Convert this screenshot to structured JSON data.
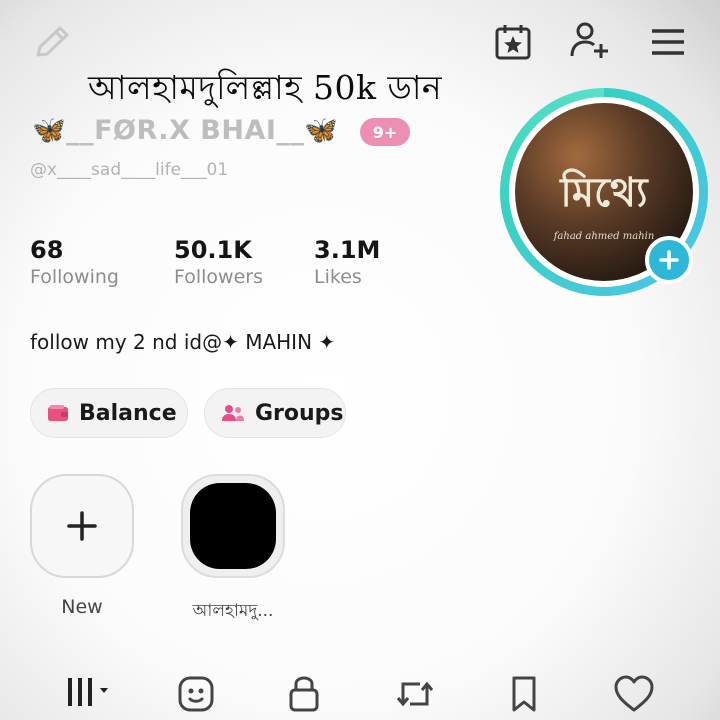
{
  "overlay": {
    "caption": "আলহামদুলিল্লাহ 50k ডান"
  },
  "topbar": {
    "icons": [
      "pencil-icon",
      "calendar-star-icon",
      "add-user-icon",
      "menu-icon"
    ]
  },
  "profile": {
    "display_name": "🦋__FØR.X BHAI__🦋",
    "badge": "9+",
    "username": "@x____sad____life___01",
    "avatar_text": "মিথ্যে",
    "avatar_subtext": "fahad ahmed mahin"
  },
  "stats": [
    {
      "value": "68",
      "label": "Following"
    },
    {
      "value": "50.1K",
      "label": "Followers"
    },
    {
      "value": "3.1M",
      "label": "Likes"
    }
  ],
  "bio": {
    "text": "follow my 2 nd id@✦ MAHIN ✦"
  },
  "buttons": {
    "balance": "Balance",
    "groups": "Groups"
  },
  "highlights": [
    {
      "label": "New"
    },
    {
      "label": "আলহামদু..."
    }
  ],
  "tabs": [
    "grid-icon",
    "repost-face-icon",
    "lock-icon",
    "repost-icon",
    "bookmark-icon",
    "heart-icon"
  ],
  "colors": {
    "accent_teal": "#35d0c4",
    "badge_pink": "#ec8fb3",
    "add_blue": "#2fb7d6",
    "balance_pink": "#e8507e",
    "groups_pink": "#e84d8a"
  }
}
